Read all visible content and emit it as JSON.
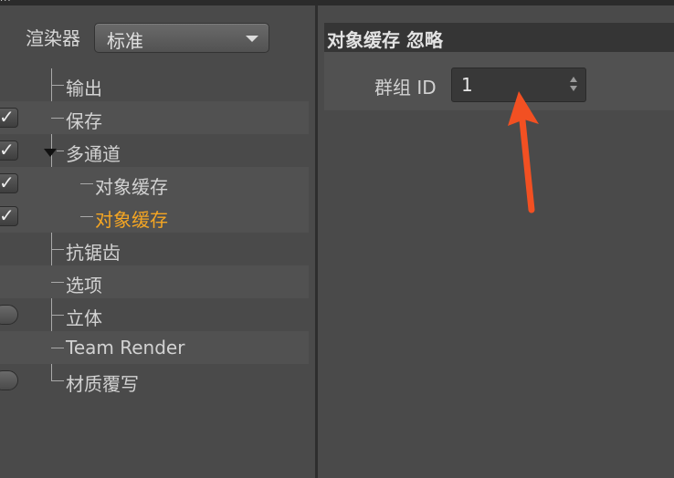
{
  "renderer": {
    "label": "渲染器",
    "value": "标准"
  },
  "tree": {
    "items": [
      {
        "label": "输出",
        "checked": null
      },
      {
        "label": "保存",
        "checked": true
      },
      {
        "label": "多通道",
        "checked": true,
        "expanded": true
      },
      {
        "label": "对象缓存",
        "checked": true
      },
      {
        "label": "对象缓存",
        "checked": true,
        "selected": true
      },
      {
        "label": "抗锯齿",
        "checked": null
      },
      {
        "label": "选项",
        "checked": null
      },
      {
        "label": "立体",
        "checked": false
      },
      {
        "label": "Team Render",
        "checked": null
      },
      {
        "label": "材质覆写",
        "checked": false
      }
    ]
  },
  "properties": {
    "section_title": "对象缓存 忽略",
    "group_id_label": "群组 ID",
    "group_id_value": "1"
  },
  "colors": {
    "selected_text": "#f5a623",
    "annotation_arrow": "#f25022"
  }
}
